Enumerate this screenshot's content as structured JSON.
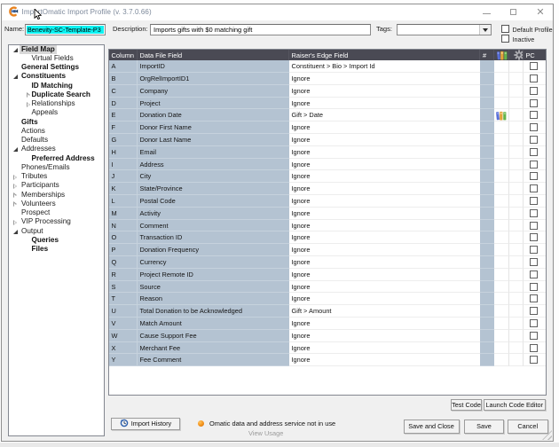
{
  "window": {
    "title": "ImportOmatic Import Profile (v. 3.7.0.66)"
  },
  "top_fields": {
    "name_label": "Name:",
    "name_value": "Benevity-SC-Template-P3",
    "description_label": "Description:",
    "description_value": "Imports gifts with $0 matching gift",
    "tags_label": "Tags:",
    "tags_value": "",
    "default_profile_label": "Default Profile",
    "default_profile_checked": false,
    "inactive_label": "Inactive",
    "inactive_checked": false
  },
  "sidebar": {
    "items": [
      {
        "label": "Field Map",
        "level": 0,
        "bold": true,
        "expander": "expanded",
        "selected": true
      },
      {
        "label": "Virtual Fields",
        "level": 1,
        "bold": false,
        "expander": "none"
      },
      {
        "label": "General Settings",
        "level": 0,
        "bold": true,
        "expander": "none"
      },
      {
        "label": "Constituents",
        "level": 0,
        "bold": true,
        "expander": "expanded"
      },
      {
        "label": "ID Matching",
        "level": 1,
        "bold": true,
        "expander": "none"
      },
      {
        "label": "Duplicate Search",
        "level": 1,
        "bold": true,
        "expander": "collapsed"
      },
      {
        "label": "Relationships",
        "level": 1,
        "bold": false,
        "expander": "collapsed"
      },
      {
        "label": "Appeals",
        "level": 1,
        "bold": false,
        "expander": "none"
      },
      {
        "label": "Gifts",
        "level": 0,
        "bold": true,
        "expander": "none"
      },
      {
        "label": "Actions",
        "level": 0,
        "bold": false,
        "expander": "none"
      },
      {
        "label": "Defaults",
        "level": 0,
        "bold": false,
        "expander": "none"
      },
      {
        "label": "Addresses",
        "level": 0,
        "bold": false,
        "expander": "expanded"
      },
      {
        "label": "Preferred Address",
        "level": 1,
        "bold": true,
        "expander": "none"
      },
      {
        "label": "Phones/Emails",
        "level": 0,
        "bold": false,
        "expander": "none"
      },
      {
        "label": "Tributes",
        "level": 0,
        "bold": false,
        "expander": "collapsed"
      },
      {
        "label": "Participants",
        "level": 0,
        "bold": false,
        "expander": "collapsed"
      },
      {
        "label": "Memberships",
        "level": 0,
        "bold": false,
        "expander": "collapsed"
      },
      {
        "label": "Volunteers",
        "level": 0,
        "bold": false,
        "expander": "collapsed"
      },
      {
        "label": "Prospect",
        "level": 0,
        "bold": false,
        "expander": "none"
      },
      {
        "label": "VIP Processing",
        "level": 0,
        "bold": false,
        "expander": "collapsed"
      },
      {
        "label": "Output",
        "level": 0,
        "bold": false,
        "expander": "expanded"
      },
      {
        "label": "Queries",
        "level": 1,
        "bold": true,
        "expander": "none"
      },
      {
        "label": "Files",
        "level": 1,
        "bold": true,
        "expander": "none"
      }
    ]
  },
  "grid": {
    "headers": {
      "column": "Column",
      "data_file_field": "Data File Field",
      "re_field": "Raiser's Edge Field",
      "num": "#",
      "dict_icon": "dictionary-icon",
      "gear_icon": "gear-icon",
      "pc": "PC"
    },
    "rows": [
      {
        "column": "A",
        "data_file_field": "ImportID",
        "re_field": "Constituent > Bio > Import Id",
        "dict": false,
        "pc_checked": false
      },
      {
        "column": "B",
        "data_file_field": "OrgRelImportID1",
        "re_field": "Ignore",
        "dict": false,
        "pc_checked": false
      },
      {
        "column": "C",
        "data_file_field": "Company",
        "re_field": "Ignore",
        "dict": false,
        "pc_checked": false
      },
      {
        "column": "D",
        "data_file_field": "Project",
        "re_field": "Ignore",
        "dict": false,
        "pc_checked": false
      },
      {
        "column": "E",
        "data_file_field": "Donation Date",
        "re_field": "Gift > Date",
        "dict": true,
        "pc_checked": false
      },
      {
        "column": "F",
        "data_file_field": "Donor First Name",
        "re_field": "Ignore",
        "dict": false,
        "pc_checked": false
      },
      {
        "column": "G",
        "data_file_field": "Donor Last Name",
        "re_field": "Ignore",
        "dict": false,
        "pc_checked": false
      },
      {
        "column": "H",
        "data_file_field": "Email",
        "re_field": "Ignore",
        "dict": false,
        "pc_checked": false
      },
      {
        "column": "I",
        "data_file_field": "Address",
        "re_field": "Ignore",
        "dict": false,
        "pc_checked": false
      },
      {
        "column": "J",
        "data_file_field": "City",
        "re_field": "Ignore",
        "dict": false,
        "pc_checked": false
      },
      {
        "column": "K",
        "data_file_field": "State/Province",
        "re_field": "Ignore",
        "dict": false,
        "pc_checked": false
      },
      {
        "column": "L",
        "data_file_field": "Postal Code",
        "re_field": "Ignore",
        "dict": false,
        "pc_checked": false
      },
      {
        "column": "M",
        "data_file_field": "Activity",
        "re_field": "Ignore",
        "dict": false,
        "pc_checked": false
      },
      {
        "column": "N",
        "data_file_field": "Comment",
        "re_field": "Ignore",
        "dict": false,
        "pc_checked": false
      },
      {
        "column": "O",
        "data_file_field": "Transaction ID",
        "re_field": "Ignore",
        "dict": false,
        "pc_checked": false
      },
      {
        "column": "P",
        "data_file_field": "Donation Frequency",
        "re_field": "Ignore",
        "dict": false,
        "pc_checked": false
      },
      {
        "column": "Q",
        "data_file_field": "Currency",
        "re_field": "Ignore",
        "dict": false,
        "pc_checked": false
      },
      {
        "column": "R",
        "data_file_field": "Project Remote ID",
        "re_field": "Ignore",
        "dict": false,
        "pc_checked": false
      },
      {
        "column": "S",
        "data_file_field": "Source",
        "re_field": "Ignore",
        "dict": false,
        "pc_checked": false
      },
      {
        "column": "T",
        "data_file_field": "Reason",
        "re_field": "Ignore",
        "dict": false,
        "pc_checked": false
      },
      {
        "column": "U",
        "data_file_field": "Total Donation to be Acknowledged",
        "re_field": "Gift > Amount",
        "dict": false,
        "pc_checked": false
      },
      {
        "column": "V",
        "data_file_field": "Match Amount",
        "re_field": "Ignore",
        "dict": false,
        "pc_checked": false
      },
      {
        "column": "W",
        "data_file_field": "Cause Support Fee",
        "re_field": "Ignore",
        "dict": false,
        "pc_checked": false
      },
      {
        "column": "X",
        "data_file_field": "Merchant Fee",
        "re_field": "Ignore",
        "dict": false,
        "pc_checked": false
      },
      {
        "column": "Y",
        "data_file_field": "Fee Comment",
        "re_field": "Ignore",
        "dict": false,
        "pc_checked": false
      }
    ]
  },
  "code_buttons": {
    "test_code": "Test Code",
    "launch_code_editor": "Launch Code Editor"
  },
  "footer": {
    "import_history": "Import History",
    "status_text": "Omatic data and address service not in use",
    "view_usage": "View Usage",
    "save_and_close": "Save and Close",
    "save": "Save",
    "cancel": "Cancel"
  }
}
